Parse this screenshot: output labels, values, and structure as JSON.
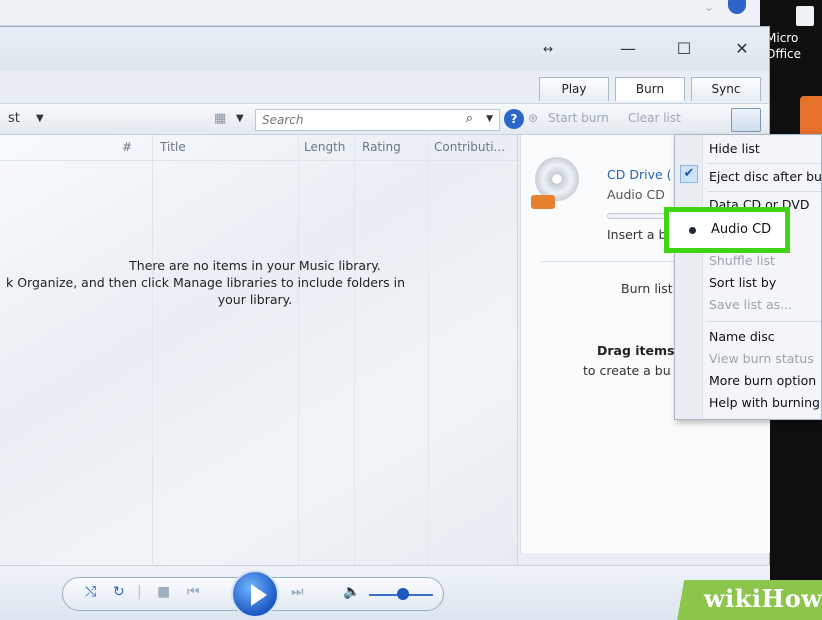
{
  "desktop": {
    "shortcut_label": "Micro\nOffice"
  },
  "window": {
    "title_buttons": {
      "snap": "↔",
      "minimize": "—",
      "maximize": "☐",
      "close": "✕"
    }
  },
  "tabs": [
    {
      "label": "Play"
    },
    {
      "label": "Burn"
    },
    {
      "label": "Sync"
    }
  ],
  "toolbar": {
    "left_label": "st",
    "search_placeholder": "Search",
    "start_burn": "Start burn",
    "clear_list": "Clear list"
  },
  "library": {
    "columns": [
      "#",
      "Title",
      "Length",
      "Rating",
      "Contributi..."
    ],
    "empty_line1": "There are no items in your Music library.",
    "empty_line2": "k Organize, and then click Manage libraries to include folders in",
    "empty_line3": "your library."
  },
  "burn_panel": {
    "drive": "CD Drive (",
    "disc_type": "Audio CD",
    "insert": "Insert a b",
    "burn_list": "Burn list",
    "drag_line1": "Drag items",
    "drag_line2": "to create a bu"
  },
  "menu": {
    "items": [
      {
        "label": "Hide list",
        "enabled": true
      },
      {
        "label": "Eject disc after bu",
        "enabled": true,
        "checked": true
      },
      {
        "label": "Data CD or DVD",
        "enabled": true
      },
      {
        "label": "Audio CD",
        "enabled": true,
        "selected": true
      },
      {
        "label": "Shuffle list",
        "enabled": false
      },
      {
        "label": "Sort list by",
        "enabled": true
      },
      {
        "label": "Save list as...",
        "enabled": false
      },
      {
        "label": "Name disc",
        "enabled": true
      },
      {
        "label": "View burn status",
        "enabled": false
      },
      {
        "label": "More burn option",
        "enabled": true
      },
      {
        "label": "Help with burning",
        "enabled": true
      }
    ]
  },
  "watermark": {
    "text": "wikiHow"
  },
  "colors": {
    "highlight": "#3fd414",
    "accent": "#2b67c9"
  }
}
